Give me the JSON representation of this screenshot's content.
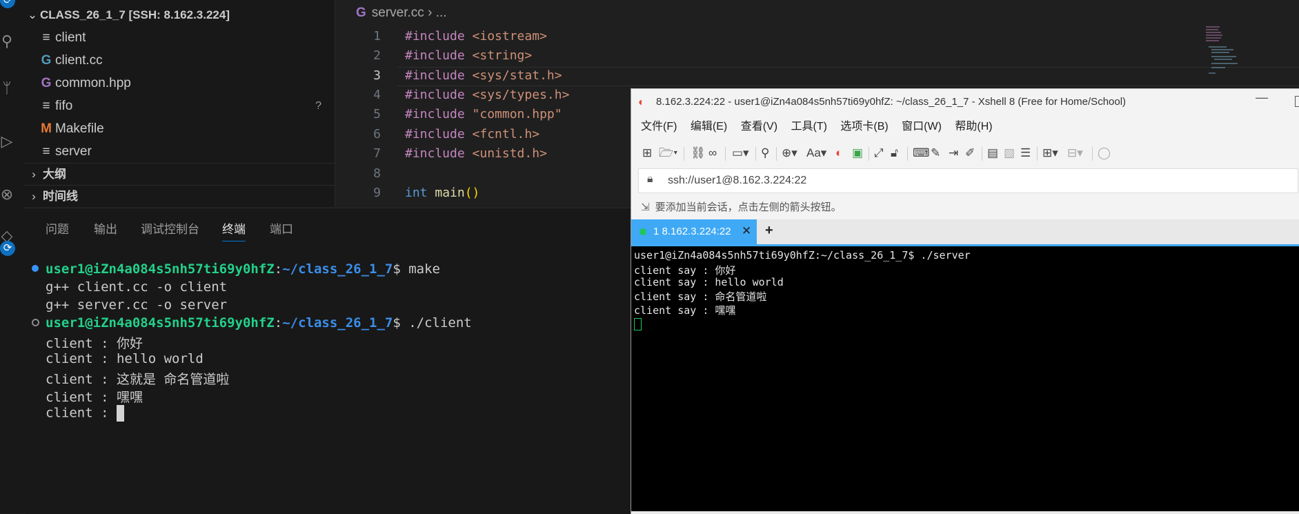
{
  "explorer": {
    "root": "CLASS_26_1_7 [SSH: 8.162.3.224]",
    "files": [
      {
        "name": "client",
        "icon": "≡",
        "color": "#cccccc",
        "status": ""
      },
      {
        "name": "client.cc",
        "icon": "G",
        "color": "#519aba",
        "status": ""
      },
      {
        "name": "common.hpp",
        "icon": "G",
        "color": "#a074c4",
        "status": ""
      },
      {
        "name": "fifo",
        "icon": "≡",
        "color": "#cccccc",
        "status": "?"
      },
      {
        "name": "Makefile",
        "icon": "M",
        "color": "#e37933",
        "status": ""
      },
      {
        "name": "server",
        "icon": "≡",
        "color": "#cccccc",
        "status": ""
      }
    ],
    "outline": "大纲",
    "timeline": "时间线"
  },
  "editor": {
    "breadcrumb_file": "server.cc",
    "breadcrumb_rest": "...",
    "lines": [
      {
        "n": "1",
        "kw": "#include",
        "rest": " <iostream>"
      },
      {
        "n": "2",
        "kw": "#include",
        "rest": " <string>"
      },
      {
        "n": "3",
        "kw": "#include",
        "rest": " <sys/stat.h>"
      },
      {
        "n": "4",
        "kw": "#include",
        "rest": " <sys/types.h>"
      },
      {
        "n": "5",
        "kw": "#include",
        "rest": " \"common.hpp\""
      },
      {
        "n": "6",
        "kw": "#include",
        "rest": " <fcntl.h>"
      },
      {
        "n": "7",
        "kw": "#include",
        "rest": " <unistd.h>"
      },
      {
        "n": "8",
        "kw": "",
        "rest": ""
      },
      {
        "n": "9",
        "kw": "int",
        "rest": "main"
      }
    ],
    "current_line": "3"
  },
  "panel": {
    "tabs": [
      "问题",
      "输出",
      "调试控制台",
      "终端",
      "端口"
    ],
    "active_tab": "终端",
    "terminal": {
      "user": "user1@iZn4a084s5nh57ti69y0hfZ",
      "path": "~/class_26_1_7",
      "cmd1": "make",
      "out1": "g++ client.cc -o client",
      "out2": "g++ server.cc -o server",
      "cmd2": "./client",
      "out3": "client : 你好",
      "out4": "client : hello world",
      "out5": "client : 这就是 命名管道啦",
      "out6": "client : 嘿嘿",
      "out7": "client : "
    }
  },
  "xshell": {
    "title": "8.162.3.224:22 - user1@iZn4a084s5nh57ti69y0hfZ: ~/class_26_1_7 - Xshell 8 (Free for Home/School)",
    "menu": [
      "文件(F)",
      "编辑(E)",
      "查看(V)",
      "工具(T)",
      "选项卡(B)",
      "窗口(W)",
      "帮助(H)"
    ],
    "address": "ssh://user1@8.162.3.224:22",
    "hint": "要添加当前会话，点击左侧的箭头按钮。",
    "tab_label": "1 8.162.3.224:22",
    "terminal_lines": [
      "user1@iZn4a084s5nh57ti69y0hfZ:~/class_26_1_7$ ./server",
      "client say : 你好",
      "client say : hello world",
      "client say : 命名管道啦",
      "client say : 嘿嘿"
    ]
  }
}
